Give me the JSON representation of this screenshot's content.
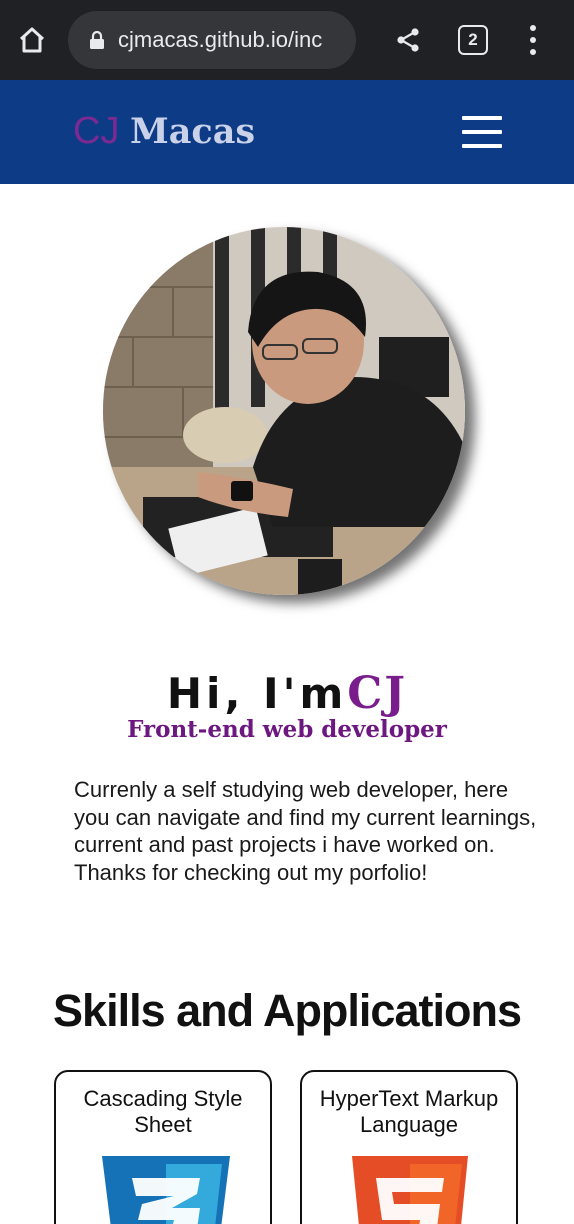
{
  "browser": {
    "url": "cjmacas.github.io/inc",
    "tab_count": "2",
    "icons": [
      "home-icon",
      "lock-icon",
      "share-icon",
      "tab-switcher-icon",
      "more-menu-icon"
    ]
  },
  "nav": {
    "logo_first": "CJ",
    "logo_last": "Macas",
    "menu_icon": "hamburger-menu-icon"
  },
  "profile": {
    "greeting": "Hi, I'm",
    "name": "CJ",
    "role": "Front-end web developer",
    "bio": "Currenly a self studying web developer, here you can navigate and find my current learnings, current and past projects i have worked on. Thanks for checking out my porfolio!"
  },
  "skills": {
    "title": "Skills and Applications",
    "items": [
      {
        "name": "Cascading Style Sheet",
        "icon": "css3-logo-icon"
      },
      {
        "name": "HyperText Markup Language",
        "icon": "html5-logo-icon"
      }
    ]
  },
  "colors": {
    "nav_bg": "#0e3b86",
    "accent_purple": "#7a1d8c",
    "chrome_bg": "#202124"
  }
}
